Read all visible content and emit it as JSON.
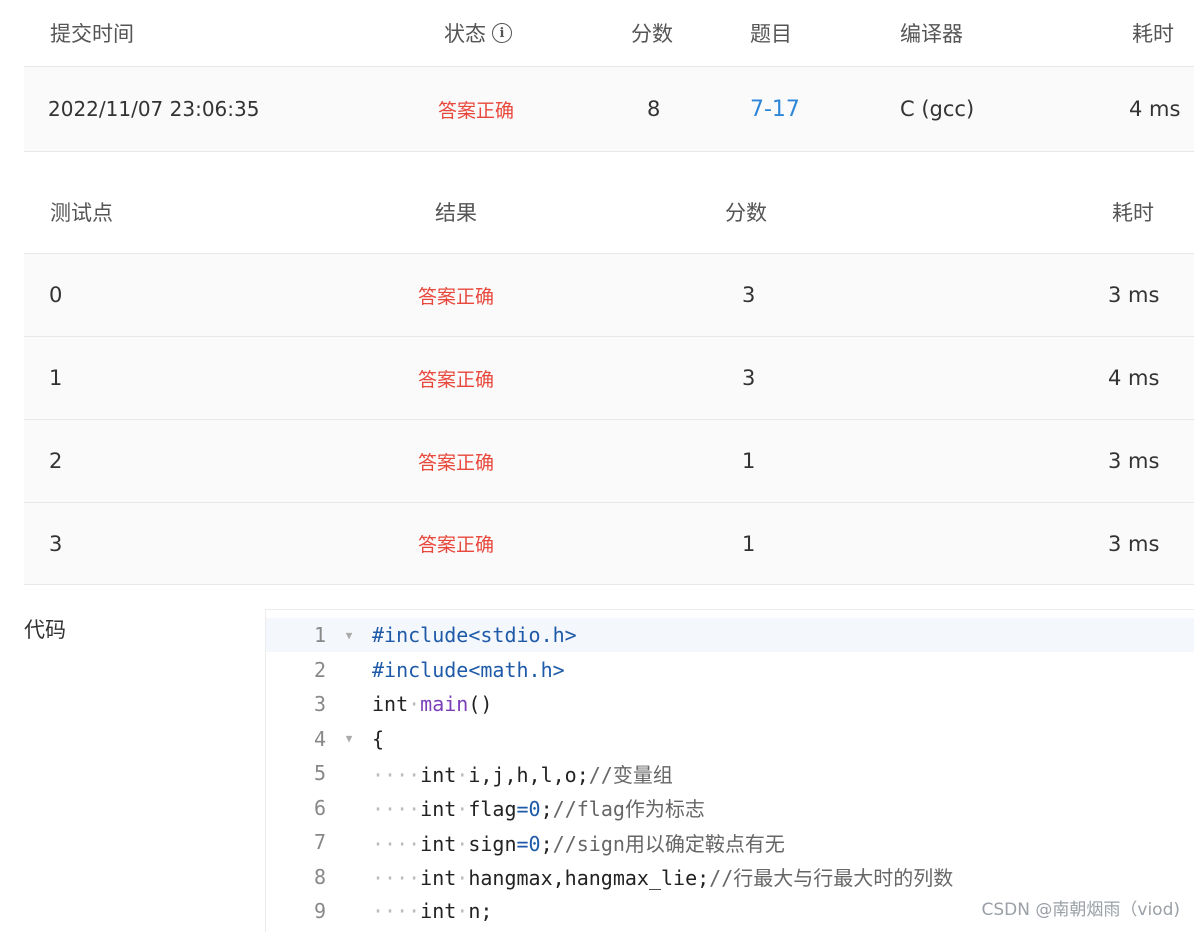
{
  "submission": {
    "headers": {
      "time": "提交时间",
      "status": "状态",
      "score": "分数",
      "problem": "题目",
      "compiler": "编译器",
      "elapsed": "耗时"
    },
    "row": {
      "time": "2022/11/07 23:06:35",
      "status": "答案正确",
      "score": "8",
      "problem": "7-17",
      "compiler": "C (gcc)",
      "elapsed": "4 ms"
    }
  },
  "tests": {
    "headers": {
      "case": "测试点",
      "result": "结果",
      "score": "分数",
      "elapsed": "耗时"
    },
    "rows": [
      {
        "case": "0",
        "result": "答案正确",
        "score": "3",
        "elapsed": "3 ms"
      },
      {
        "case": "1",
        "result": "答案正确",
        "score": "3",
        "elapsed": "4 ms"
      },
      {
        "case": "2",
        "result": "答案正确",
        "score": "1",
        "elapsed": "3 ms"
      },
      {
        "case": "3",
        "result": "答案正确",
        "score": "1",
        "elapsed": "3 ms"
      }
    ]
  },
  "code": {
    "label": "代码",
    "lines": [
      {
        "n": "1",
        "fold": "▼",
        "tokens": [
          {
            "c": "inc",
            "t": "#include<stdio.h>"
          }
        ]
      },
      {
        "n": "2",
        "fold": "",
        "tokens": [
          {
            "c": "inc",
            "t": "#include<math.h>"
          }
        ]
      },
      {
        "n": "3",
        "fold": "",
        "tokens": [
          {
            "c": "kw",
            "t": "int"
          },
          {
            "c": "dot",
            "t": "·"
          },
          {
            "c": "fn",
            "t": "main"
          },
          {
            "c": "kw",
            "t": "()"
          }
        ]
      },
      {
        "n": "4",
        "fold": "▼",
        "tokens": [
          {
            "c": "kw",
            "t": "{"
          }
        ]
      },
      {
        "n": "5",
        "fold": "",
        "tokens": [
          {
            "c": "dot",
            "t": "····"
          },
          {
            "c": "kw",
            "t": "int"
          },
          {
            "c": "dot",
            "t": "·"
          },
          {
            "c": "kw",
            "t": "i,j,h,l,o;"
          },
          {
            "c": "cmt",
            "t": "//变量组"
          }
        ]
      },
      {
        "n": "6",
        "fold": "",
        "tokens": [
          {
            "c": "dot",
            "t": "····"
          },
          {
            "c": "kw",
            "t": "int"
          },
          {
            "c": "dot",
            "t": "·"
          },
          {
            "c": "kw",
            "t": "flag"
          },
          {
            "c": "num",
            "t": "=0"
          },
          {
            "c": "kw",
            "t": ";"
          },
          {
            "c": "cmt",
            "t": "//flag作为标志"
          }
        ]
      },
      {
        "n": "7",
        "fold": "",
        "tokens": [
          {
            "c": "dot",
            "t": "····"
          },
          {
            "c": "kw",
            "t": "int"
          },
          {
            "c": "dot",
            "t": "·"
          },
          {
            "c": "kw",
            "t": "sign"
          },
          {
            "c": "num",
            "t": "=0"
          },
          {
            "c": "kw",
            "t": ";"
          },
          {
            "c": "cmt",
            "t": "//sign用以确定鞍点有无"
          }
        ]
      },
      {
        "n": "8",
        "fold": "",
        "tokens": [
          {
            "c": "dot",
            "t": "····"
          },
          {
            "c": "kw",
            "t": "int"
          },
          {
            "c": "dot",
            "t": "·"
          },
          {
            "c": "kw",
            "t": "hangmax,hangmax_lie;"
          },
          {
            "c": "cmt",
            "t": "//行最大与行最大时的列数"
          }
        ]
      },
      {
        "n": "9",
        "fold": "",
        "tokens": [
          {
            "c": "dot",
            "t": "····"
          },
          {
            "c": "kw",
            "t": "int"
          },
          {
            "c": "dot",
            "t": "·"
          },
          {
            "c": "kw",
            "t": "n;"
          }
        ]
      }
    ]
  },
  "watermark": "CSDN @南朝烟雨（viod)"
}
